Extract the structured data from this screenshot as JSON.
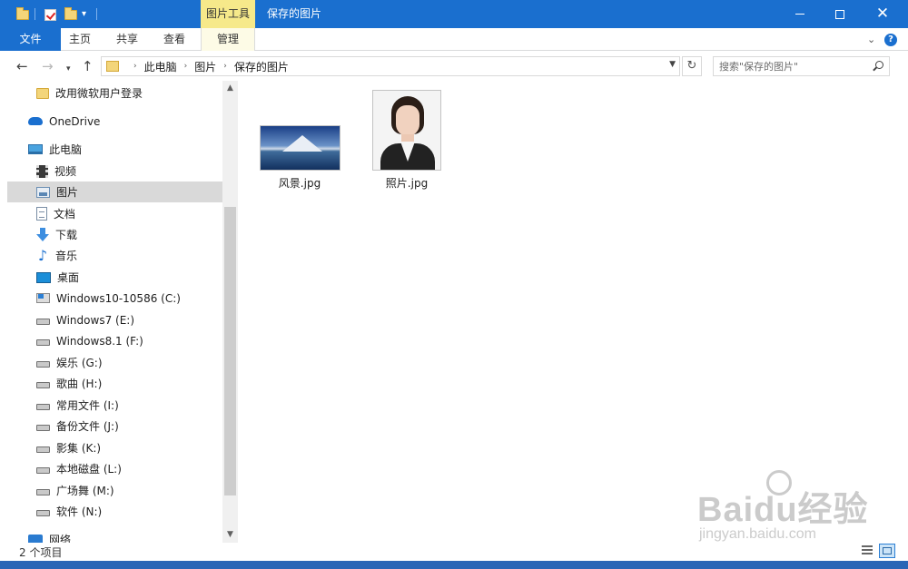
{
  "titlebar": {
    "contextual_tab": "图片工具",
    "window_title": "保存的图片",
    "background": "#1a6fcf"
  },
  "ribbon": {
    "tabs": [
      "文件",
      "主页",
      "共享",
      "查看",
      "管理"
    ]
  },
  "address": {
    "crumbs": [
      "此电脑",
      "图片",
      "保存的图片"
    ],
    "search_placeholder": "搜索\"保存的图片\""
  },
  "nav": {
    "items": [
      {
        "label": "改用微软用户登录",
        "icon": "folder-icon"
      },
      {
        "label": "OneDrive",
        "icon": "onedrive-icon"
      },
      {
        "label": "此电脑",
        "icon": "computer-icon"
      },
      {
        "label": "视频",
        "icon": "video-icon"
      },
      {
        "label": "图片",
        "icon": "pictures-icon"
      },
      {
        "label": "文档",
        "icon": "documents-icon"
      },
      {
        "label": "下载",
        "icon": "download-icon"
      },
      {
        "label": "音乐",
        "icon": "music-icon"
      },
      {
        "label": "桌面",
        "icon": "desktop-icon"
      },
      {
        "label": "Windows10-10586 (C:)",
        "icon": "windows-drive-icon"
      },
      {
        "label": "Windows7 (E:)",
        "icon": "drive-icon"
      },
      {
        "label": "Windows8.1 (F:)",
        "icon": "drive-icon"
      },
      {
        "label": "娱乐 (G:)",
        "icon": "drive-icon"
      },
      {
        "label": "歌曲 (H:)",
        "icon": "drive-icon"
      },
      {
        "label": "常用文件 (I:)",
        "icon": "drive-icon"
      },
      {
        "label": "备份文件 (J:)",
        "icon": "drive-icon"
      },
      {
        "label": "影集 (K:)",
        "icon": "drive-icon"
      },
      {
        "label": "本地磁盘 (L:)",
        "icon": "drive-icon"
      },
      {
        "label": "广场舞 (M:)",
        "icon": "drive-icon"
      },
      {
        "label": "软件 (N:)",
        "icon": "drive-icon"
      },
      {
        "label": "网络",
        "icon": "network-icon"
      }
    ],
    "selected": "图片"
  },
  "files": [
    {
      "name": "风景.jpg",
      "thumbnail": "landscape"
    },
    {
      "name": "照片.jpg",
      "thumbnail": "portrait"
    }
  ],
  "status": {
    "item_count": "2 个项目"
  },
  "watermark": {
    "logo": "Baidu经验",
    "url": "jingyan.baidu.com"
  }
}
